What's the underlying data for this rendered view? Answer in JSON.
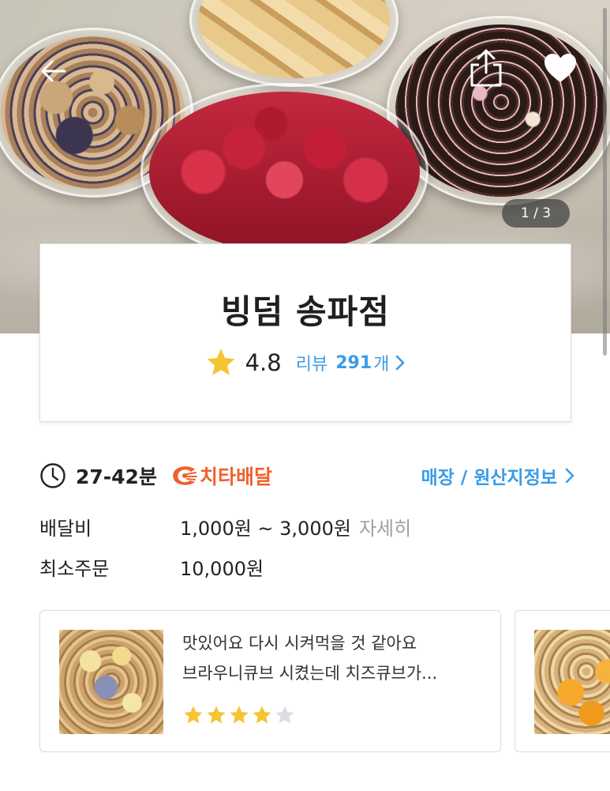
{
  "hero": {
    "page_counter": "1 / 3",
    "icons": {
      "back": "back-arrow-icon",
      "share": "share-icon",
      "favorite": "heart-icon"
    }
  },
  "store": {
    "name": "빙덤 송파점",
    "rating": "4.8",
    "review_label": "리뷰",
    "review_count": "291",
    "review_unit": "개"
  },
  "delivery": {
    "eta": "27-42분",
    "badge_label": "치타배달",
    "badge_color": "#f0612e",
    "store_info_link": "매장 / 원산지정보",
    "fee_label": "배달비",
    "fee_value": "1,000원 ~ 3,000원",
    "fee_detail": "자세히",
    "min_order_label": "최소주문",
    "min_order_value": "10,000원"
  },
  "reviews": [
    {
      "line1": "맛있어요 다시 시켜먹을 것 같아요",
      "line2": "브라우니큐브 시켰는데 치즈큐브가...",
      "stars": 4,
      "max_stars": 5
    }
  ],
  "colors": {
    "accent": "#3a9ce8",
    "star": "#f5c431",
    "star_empty": "#dcdde3"
  }
}
